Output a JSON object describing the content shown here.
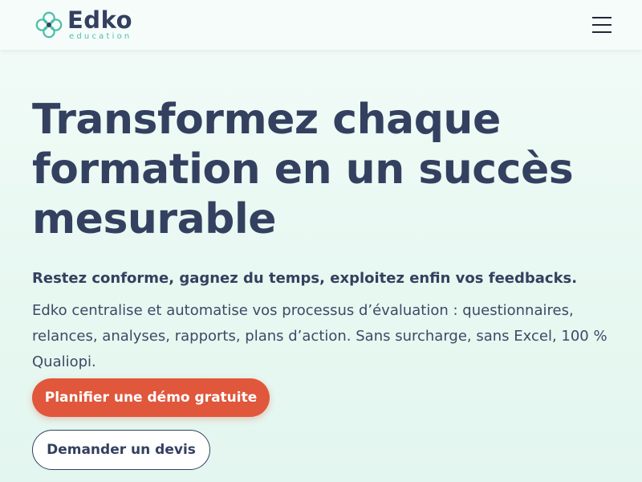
{
  "header": {
    "brand_name": "Edko",
    "brand_sub": "education",
    "logo_icon": "clover-knot-logo",
    "menu_icon": "hamburger-menu-icon"
  },
  "hero": {
    "headline": "Transformez chaque formation en un succès mesurable",
    "subtitle": "Restez conforme, gagnez du temps, exploitez enfin vos feedbacks.",
    "description": "Edko centralise et automatise vos processus d’évaluation : questionnaires, relances, analyses, rapports, plans d’action. Sans surcharge, sans Excel, 100 % Qualiopi.",
    "primary_cta": "Planifier une démo gratuite",
    "secondary_cta": "Demander un devis"
  },
  "colors": {
    "navy": "#33405f",
    "teal": "#4dbfa8",
    "cta_orange": "#e0573c",
    "background": "#e9f8f3"
  }
}
